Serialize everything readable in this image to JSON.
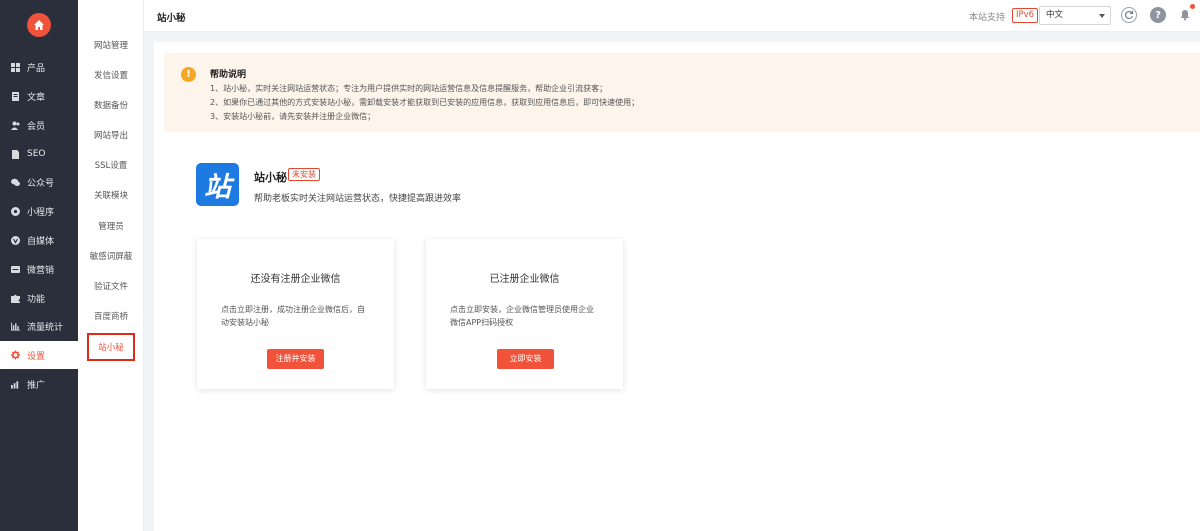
{
  "sidebar": {
    "items": [
      {
        "icon": "grid-icon",
        "label": "产品",
        "active": false
      },
      {
        "icon": "document-icon",
        "label": "文章",
        "active": false
      },
      {
        "icon": "users-icon",
        "label": "会员",
        "active": false
      },
      {
        "icon": "seo-icon",
        "label": "SEO",
        "active": false
      },
      {
        "icon": "wechat-icon",
        "label": "公众号",
        "active": false
      },
      {
        "icon": "mini-program-icon",
        "label": "小程序",
        "active": false
      },
      {
        "icon": "media-icon",
        "label": "自媒体",
        "active": false
      },
      {
        "icon": "marketing-icon",
        "label": "微营销",
        "active": false
      },
      {
        "icon": "puzzle-icon",
        "label": "功能",
        "active": false
      },
      {
        "icon": "bar-chart-icon",
        "label": "流量统计",
        "active": false
      },
      {
        "icon": "gear-icon",
        "label": "设置",
        "active": true
      },
      {
        "icon": "promote-icon",
        "label": "推广",
        "active": false
      }
    ]
  },
  "subnav": {
    "items": [
      "网站管理",
      "发信设置",
      "数据备份",
      "网站导出",
      "SSL设置",
      "关联模块",
      "管理员",
      "敏感词屏蔽",
      "验证文件",
      "百度商桥",
      "站小秘"
    ]
  },
  "header": {
    "title": "站小秘",
    "support_label": "本站支持",
    "ipv6_badge": "IPv6",
    "language_value": "中文"
  },
  "help": {
    "title": "帮助说明",
    "lines": [
      "1、站小秘，实时关注网站运营状态；专注为用户提供实时的网站运营信息及信息提醒服务，帮助企业引流获客；",
      "2、如果你已通过其他的方式安装站小秘，需卸载安装才能获取到已安装的应用信息，获取到应用信息后，即可快速使用；",
      "3、安装站小秘前，请先安装并注册企业微信；"
    ]
  },
  "app": {
    "logo_char": "站",
    "name": "站小秘",
    "status_badge": "未安装",
    "description": "帮助老板实时关注网站运营状态，快捷提高跟进效率"
  },
  "cards": [
    {
      "title": "还没有注册企业微信",
      "text": "点击立即注册，成功注册企业微信后，自动安装站小秘",
      "button": "注册并安装"
    },
    {
      "title": "已注册企业微信",
      "text": "点击立即安装，企业微信管理员使用企业微信APP扫码授权",
      "button": "立即安装"
    }
  ],
  "colors": {
    "accent": "#f0523a",
    "sidebar_bg": "#2a2f3b",
    "help_bg": "#fdf5ec",
    "warning": "#f5a623",
    "logo_blue": "#1d7ae0"
  }
}
